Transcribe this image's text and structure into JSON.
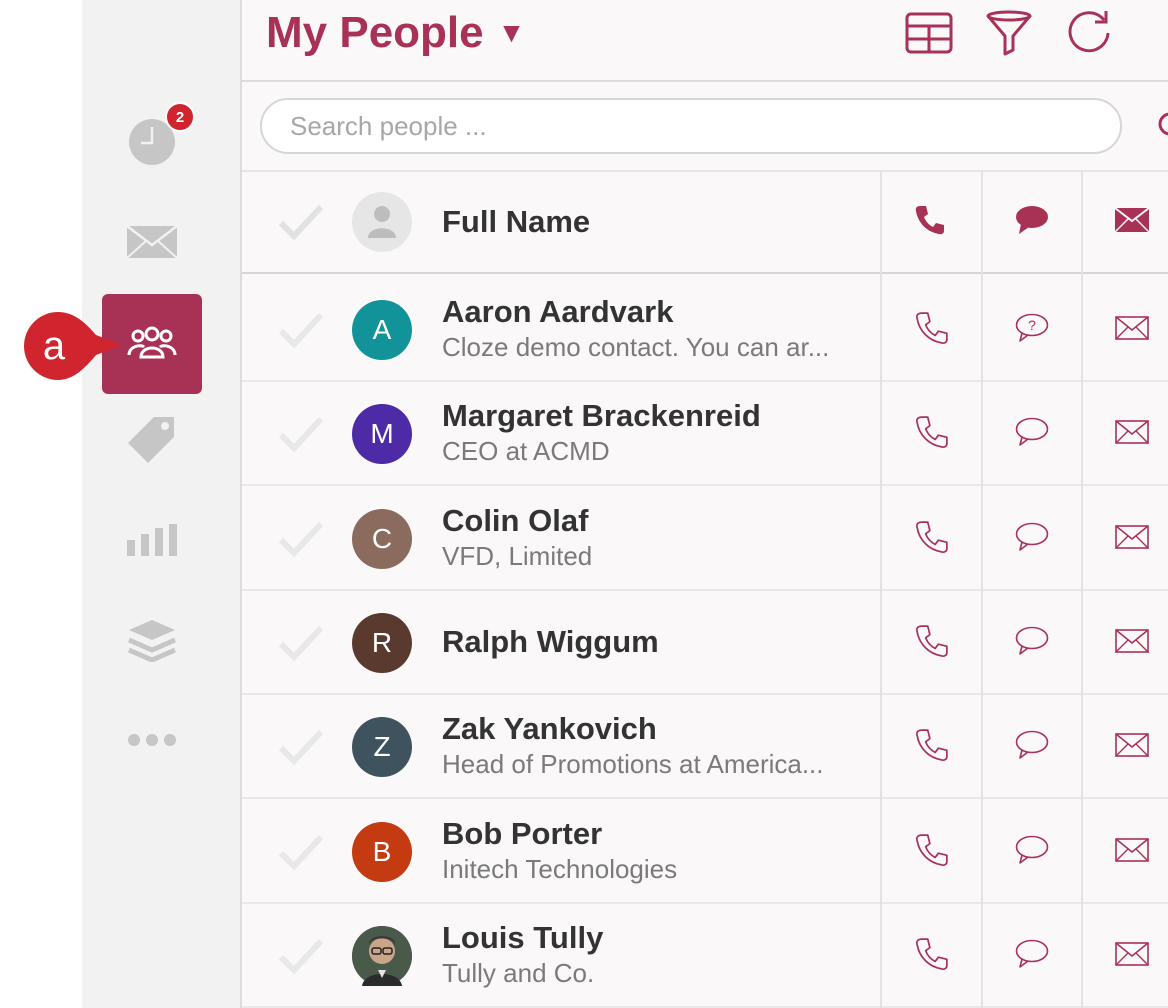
{
  "header": {
    "title": "My People",
    "caret": "▼"
  },
  "sidebar": {
    "items": [
      {
        "name": "activity",
        "icon": "clock-icon",
        "badge": "2"
      },
      {
        "name": "inbox",
        "icon": "envelope-icon"
      },
      {
        "name": "people",
        "icon": "people-icon",
        "active": true
      },
      {
        "name": "tags",
        "icon": "tag-icon"
      },
      {
        "name": "reports",
        "icon": "bar-chart-icon"
      },
      {
        "name": "layers",
        "icon": "layers-icon"
      },
      {
        "name": "more",
        "icon": "more-dots-icon"
      }
    ],
    "callout_label": "a"
  },
  "search": {
    "placeholder": "Search people ..."
  },
  "table": {
    "header_label": "Full Name",
    "rows": [
      {
        "name": "Aaron Aardvark",
        "subtitle": "Cloze demo contact. You can ar...",
        "initial": "A",
        "color": "#12939a",
        "message_icon": "question-bubble-icon"
      },
      {
        "name": "Margaret Brackenreid",
        "subtitle": "CEO at ACMD",
        "initial": "M",
        "color": "#4d2aa6",
        "message_icon": "speech-bubble-icon"
      },
      {
        "name": "Colin Olaf",
        "subtitle": "VFD, Limited",
        "initial": "C",
        "color": "#8b6b5e",
        "message_icon": "speech-bubble-icon"
      },
      {
        "name": "Ralph Wiggum",
        "subtitle": "",
        "initial": "R",
        "color": "#5a3a2e",
        "message_icon": "speech-bubble-icon"
      },
      {
        "name": "Zak Yankovich",
        "subtitle": "Head of Promotions at America...",
        "initial": "Z",
        "color": "#3f535f",
        "message_icon": "speech-bubble-icon"
      },
      {
        "name": "Bob Porter",
        "subtitle": "Initech Technologies",
        "initial": "B",
        "color": "#c43a11",
        "message_icon": "speech-bubble-icon"
      },
      {
        "name": "Louis Tully",
        "subtitle": "Tully and Co.",
        "initial": "",
        "color": "#6b6b6b",
        "photo": true,
        "message_icon": "speech-bubble-icon"
      }
    ]
  },
  "colors": {
    "accent": "#a83256",
    "badge": "#d0252f",
    "callout": "#d0252f"
  }
}
